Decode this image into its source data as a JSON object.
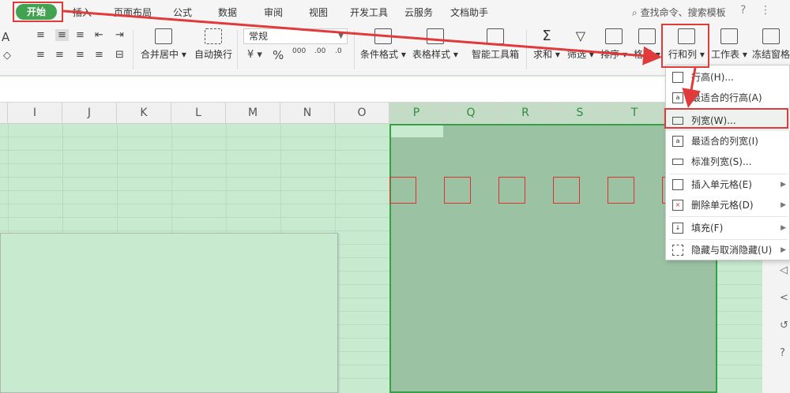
{
  "menu": {
    "start": "开始",
    "items": [
      "插入",
      "页面布局",
      "公式",
      "数据",
      "审阅",
      "视图",
      "开发工具",
      "云服务",
      "文档助手"
    ],
    "search": "查找命令、搜索模板",
    "help_glyph": "?",
    "more_glyph": "⋮"
  },
  "ribbon": {
    "merge_center": "合并居中",
    "auto_wrap": "自动换行",
    "number_format": "常规",
    "currency": "¥",
    "percent": "%",
    "thousands": "000",
    "inc_decimal": ".00",
    "dec_decimal": ".0",
    "conditional_format": "条件格式",
    "table_style": "表格样式",
    "smart_toolbox": "智能工具箱",
    "sum": "求和",
    "filter": "筛选",
    "sort": "排序",
    "format": "格式",
    "row_col": "行和列",
    "worksheet": "工作表",
    "freeze": "冻结窗格",
    "font_glyph": "A"
  },
  "columns": [
    "I",
    "J",
    "K",
    "L",
    "M",
    "N",
    "O",
    "P",
    "Q",
    "R",
    "S",
    "T"
  ],
  "dropdown": {
    "items": [
      {
        "label": "行高(H)...",
        "icon": "row-height-icon",
        "has_sub": false
      },
      {
        "label": "最适合的行高(A)",
        "icon": "fit-row-height-icon",
        "has_sub": false
      },
      {
        "label": "列宽(W)...",
        "icon": "column-width-icon",
        "has_sub": false
      },
      {
        "label": "最适合的列宽(I)",
        "icon": "fit-column-width-icon",
        "has_sub": false
      },
      {
        "label": "标准列宽(S)...",
        "icon": "standard-width-icon",
        "has_sub": false
      },
      {
        "label": "插入单元格(E)",
        "icon": "insert-cell-icon",
        "has_sub": true
      },
      {
        "label": "删除单元格(D)",
        "icon": "delete-cell-icon",
        "has_sub": true
      },
      {
        "label": "填充(F)",
        "icon": "fill-icon",
        "has_sub": true
      },
      {
        "label": "隐藏与取消隐藏(U)",
        "icon": "hide-unhide-icon",
        "has_sub": true
      }
    ]
  },
  "colors": {
    "accent": "#41a34f",
    "annotation_red": "#e03a3a",
    "sheet_bg": "#c8ebd0"
  }
}
